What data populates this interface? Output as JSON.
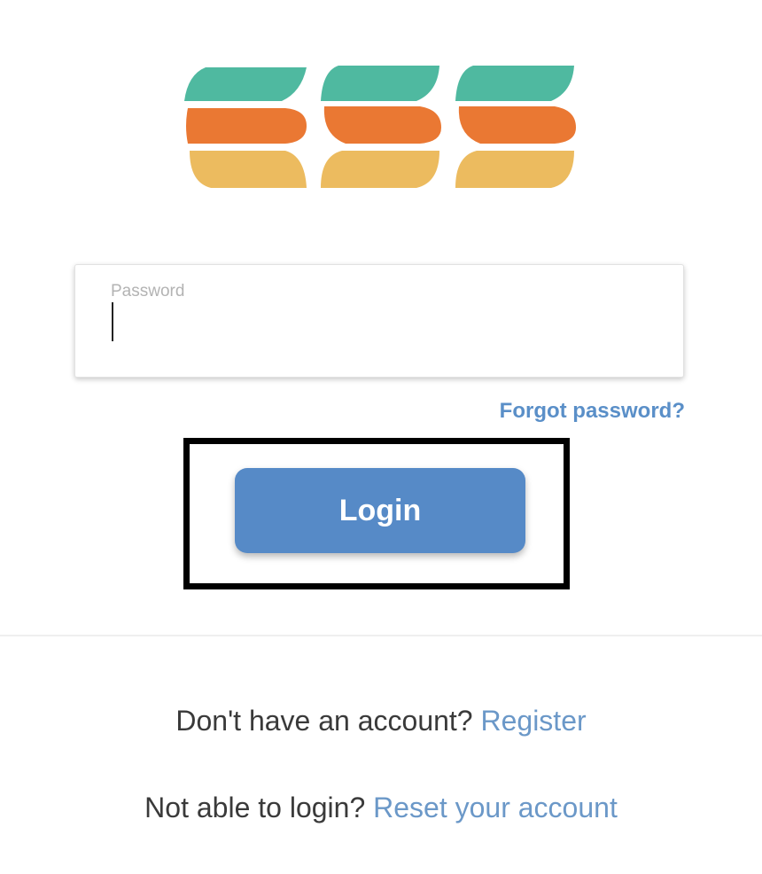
{
  "logo": {
    "colors": {
      "top": "#4fb9a0",
      "middle": "#ea7833",
      "bottom": "#ecbb5f"
    }
  },
  "password": {
    "label": "Password",
    "value": ""
  },
  "forgot_password": "Forgot password?",
  "login_button": "Login",
  "register": {
    "prompt": "Don't have an account?",
    "link": "Register"
  },
  "reset": {
    "prompt": "Not able to login?",
    "link": "Reset your account"
  },
  "colors": {
    "accent": "#568ac7",
    "link": "#6b98c8",
    "forgot_link": "#5a8fc8",
    "highlight": "#000000"
  }
}
